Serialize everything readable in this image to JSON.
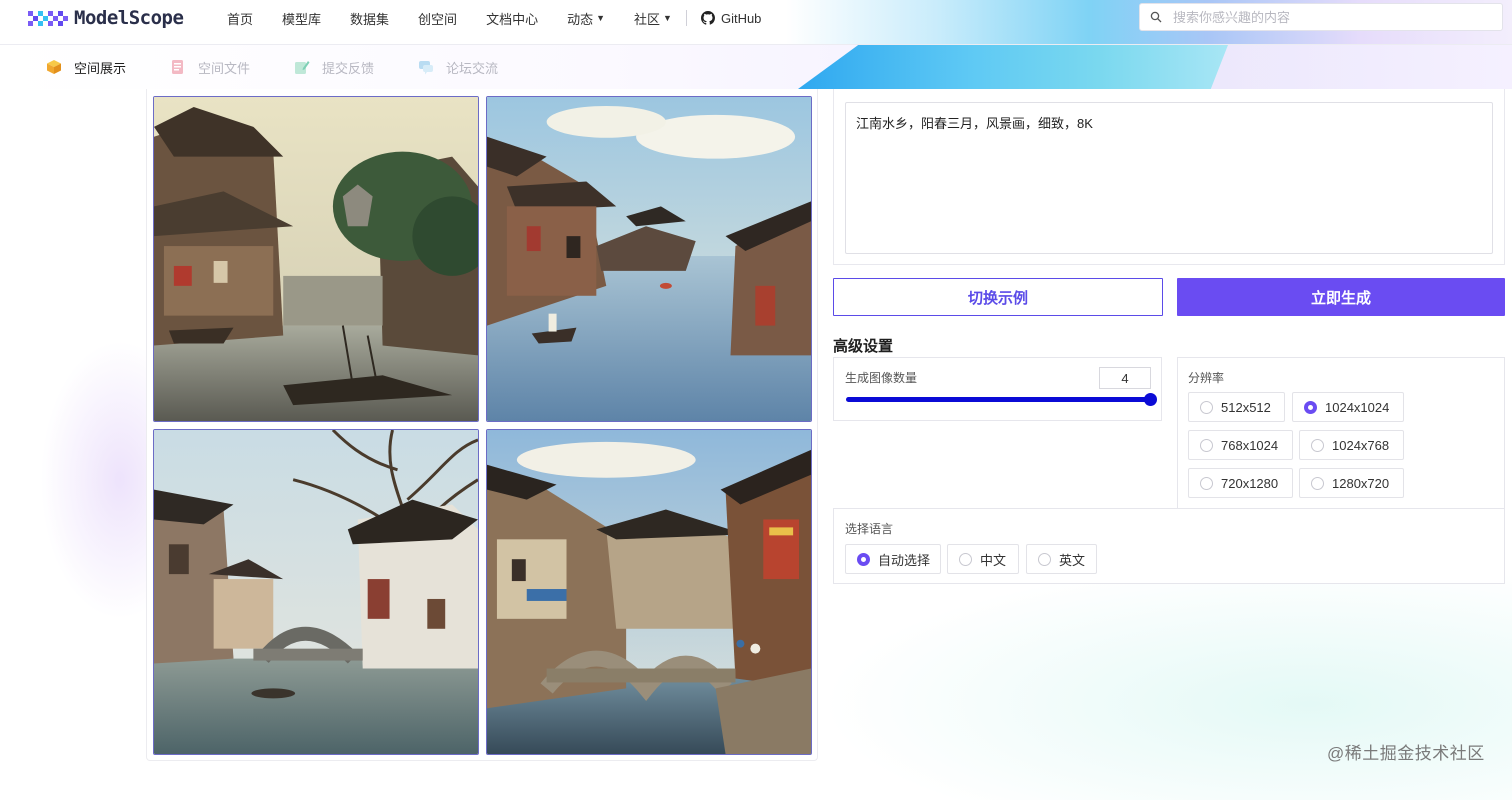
{
  "brand": {
    "name": "ModelScope"
  },
  "nav": {
    "items": [
      {
        "label": "首页"
      },
      {
        "label": "模型库"
      },
      {
        "label": "数据集"
      },
      {
        "label": "创空间"
      },
      {
        "label": "文档中心"
      },
      {
        "label": "动态",
        "has_dropdown": true
      },
      {
        "label": "社区",
        "has_dropdown": true
      }
    ],
    "github_label": "GitHub",
    "search_placeholder": "搜索你感兴趣的内容"
  },
  "sub_tabs": [
    {
      "label": "空间展示",
      "icon": "box-icon",
      "active": true
    },
    {
      "label": "空间文件",
      "icon": "file-icon",
      "active": false
    },
    {
      "label": "提交反馈",
      "icon": "edit-icon",
      "active": false
    },
    {
      "label": "论坛交流",
      "icon": "chat-icon",
      "active": false
    }
  ],
  "gallery": {
    "images": [
      {
        "name": "watertown-painting-1"
      },
      {
        "name": "watertown-painting-2"
      },
      {
        "name": "watertown-painting-3"
      },
      {
        "name": "watertown-painting-4"
      }
    ]
  },
  "prompt": {
    "value": "江南水乡，阳春三月，风景画，细致，8K"
  },
  "buttons": {
    "switch_example": "切换示例",
    "generate": "立即生成"
  },
  "advanced": {
    "title": "高级设置",
    "image_count": {
      "label": "生成图像数量",
      "value": "4",
      "slider_fraction": 1.0
    },
    "resolution": {
      "label": "分辨率",
      "options": [
        "512x512",
        "1024x1024",
        "768x1024",
        "1024x768",
        "720x1280",
        "1280x720"
      ],
      "selected": "1024x1024"
    },
    "language": {
      "label": "选择语言",
      "options": [
        "自动选择",
        "中文",
        "英文"
      ],
      "selected": "自动选择"
    }
  },
  "watermark": "@稀土掘金技术社区",
  "colors": {
    "accent": "#6a4cf2",
    "slider": "#0b0bd6",
    "thumb_border": "#6c6cc6"
  }
}
